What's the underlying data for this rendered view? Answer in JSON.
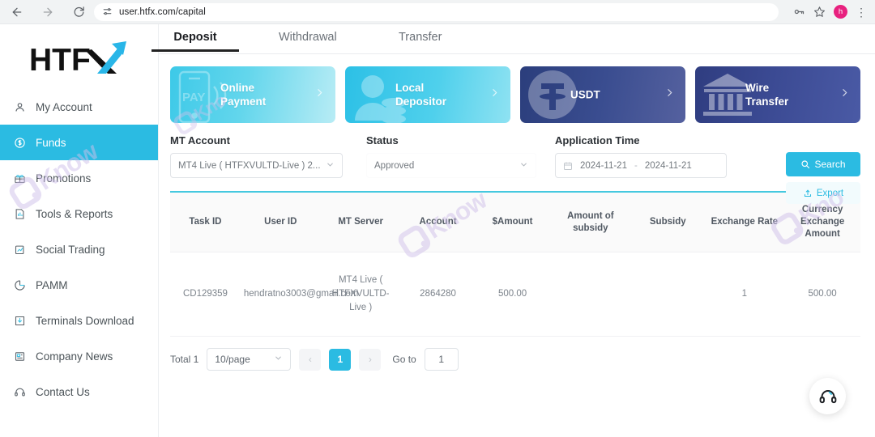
{
  "browser": {
    "url": "user.htfx.com/capital",
    "back_icon": "back-arrow-icon",
    "forward_icon": "forward-arrow-icon",
    "reload_icon": "reload-icon",
    "site_settings_icon": "site-settings-icon",
    "password_icon": "password-key-icon",
    "bookmark_icon": "star-icon",
    "avatar_letter": "h",
    "menu_icon": "kebab-menu-icon"
  },
  "sidebar": {
    "logo": "HTFX",
    "items": [
      {
        "label": "My Account",
        "icon": "user-icon",
        "active": false
      },
      {
        "label": "Funds",
        "icon": "dollar-circle-icon",
        "active": true
      },
      {
        "label": "Promotions",
        "icon": "gift-icon",
        "active": false
      },
      {
        "label": "Tools & Reports",
        "icon": "report-chart-icon",
        "active": false
      },
      {
        "label": "Social Trading",
        "icon": "trending-chart-icon",
        "active": false
      },
      {
        "label": "PAMM",
        "icon": "pie-chart-icon",
        "active": false
      },
      {
        "label": "Terminals Download",
        "icon": "download-icon",
        "active": false
      },
      {
        "label": "Company News",
        "icon": "news-icon",
        "active": false
      },
      {
        "label": "Contact Us",
        "icon": "headset-icon",
        "active": false
      }
    ]
  },
  "tabs": [
    {
      "label": "Deposit",
      "active": true
    },
    {
      "label": "Withdrawal",
      "active": false
    },
    {
      "label": "Transfer",
      "active": false
    }
  ],
  "payment_cards": [
    {
      "label": "Online\nPayment",
      "icon": "mobile-pay-icon",
      "chevron": "chevron-right-icon"
    },
    {
      "label": "Local\nDepositor",
      "icon": "person-coins-icon",
      "chevron": "chevron-right-icon"
    },
    {
      "label": "USDT",
      "icon": "tether-icon",
      "chevron": "chevron-right-icon"
    },
    {
      "label": "Wire\nTransfer",
      "icon": "bank-building-icon",
      "chevron": "chevron-right-icon"
    }
  ],
  "filters": {
    "mt_account": {
      "label": "MT Account",
      "value": "MT4 Live ( HTFXVULTD-Live ) 2...",
      "caret": "chevron-down-icon"
    },
    "status": {
      "label": "Status",
      "value": "Approved",
      "caret": "chevron-down-icon"
    },
    "application_time": {
      "label": "Application Time",
      "calendar_icon": "calendar-icon",
      "start": "2024-11-21",
      "separator": "-",
      "end": "2024-11-21"
    },
    "search_button": {
      "label": "Search",
      "icon": "search-icon"
    },
    "export_button": {
      "label": "Export",
      "icon": "upload-icon"
    }
  },
  "table": {
    "headers": [
      "Task ID",
      "User ID",
      "MT Server",
      "Account",
      "$Amount",
      "Amount of subsidy",
      "Subsidy",
      "Exchange Rate",
      "Currency Exchange Amount"
    ],
    "rows": [
      {
        "task_id": "CD129359",
        "user_id": "hendratno3003@gmail.com",
        "mt_server": "MT4 Live ( HTFXVULTD-Live )",
        "account": "2864280",
        "amount": "500.00",
        "amount_of_subsidy": "",
        "subsidy": "",
        "exchange_rate": "1",
        "currency_exchange_amount": "500.00"
      }
    ]
  },
  "pagination": {
    "total": "Total 1",
    "page_size": "10/page",
    "page_size_caret": "chevron-down-icon",
    "prev": "‹",
    "next": "›",
    "current_page": "1",
    "goto_label": "Go to",
    "goto_value": "1"
  },
  "support": {
    "icon": "headset-icon"
  },
  "watermarks": [
    {
      "text": "Know"
    },
    {
      "text": "Know"
    },
    {
      "text": "Kno"
    },
    {
      "text": "Kno"
    }
  ],
  "colors": {
    "accent": "#2bbbe2",
    "table_top_border": "#45c8df",
    "card_dark": "#2b3e7c",
    "avatar": "#e8217f",
    "watermark": "#cfc0ea"
  }
}
